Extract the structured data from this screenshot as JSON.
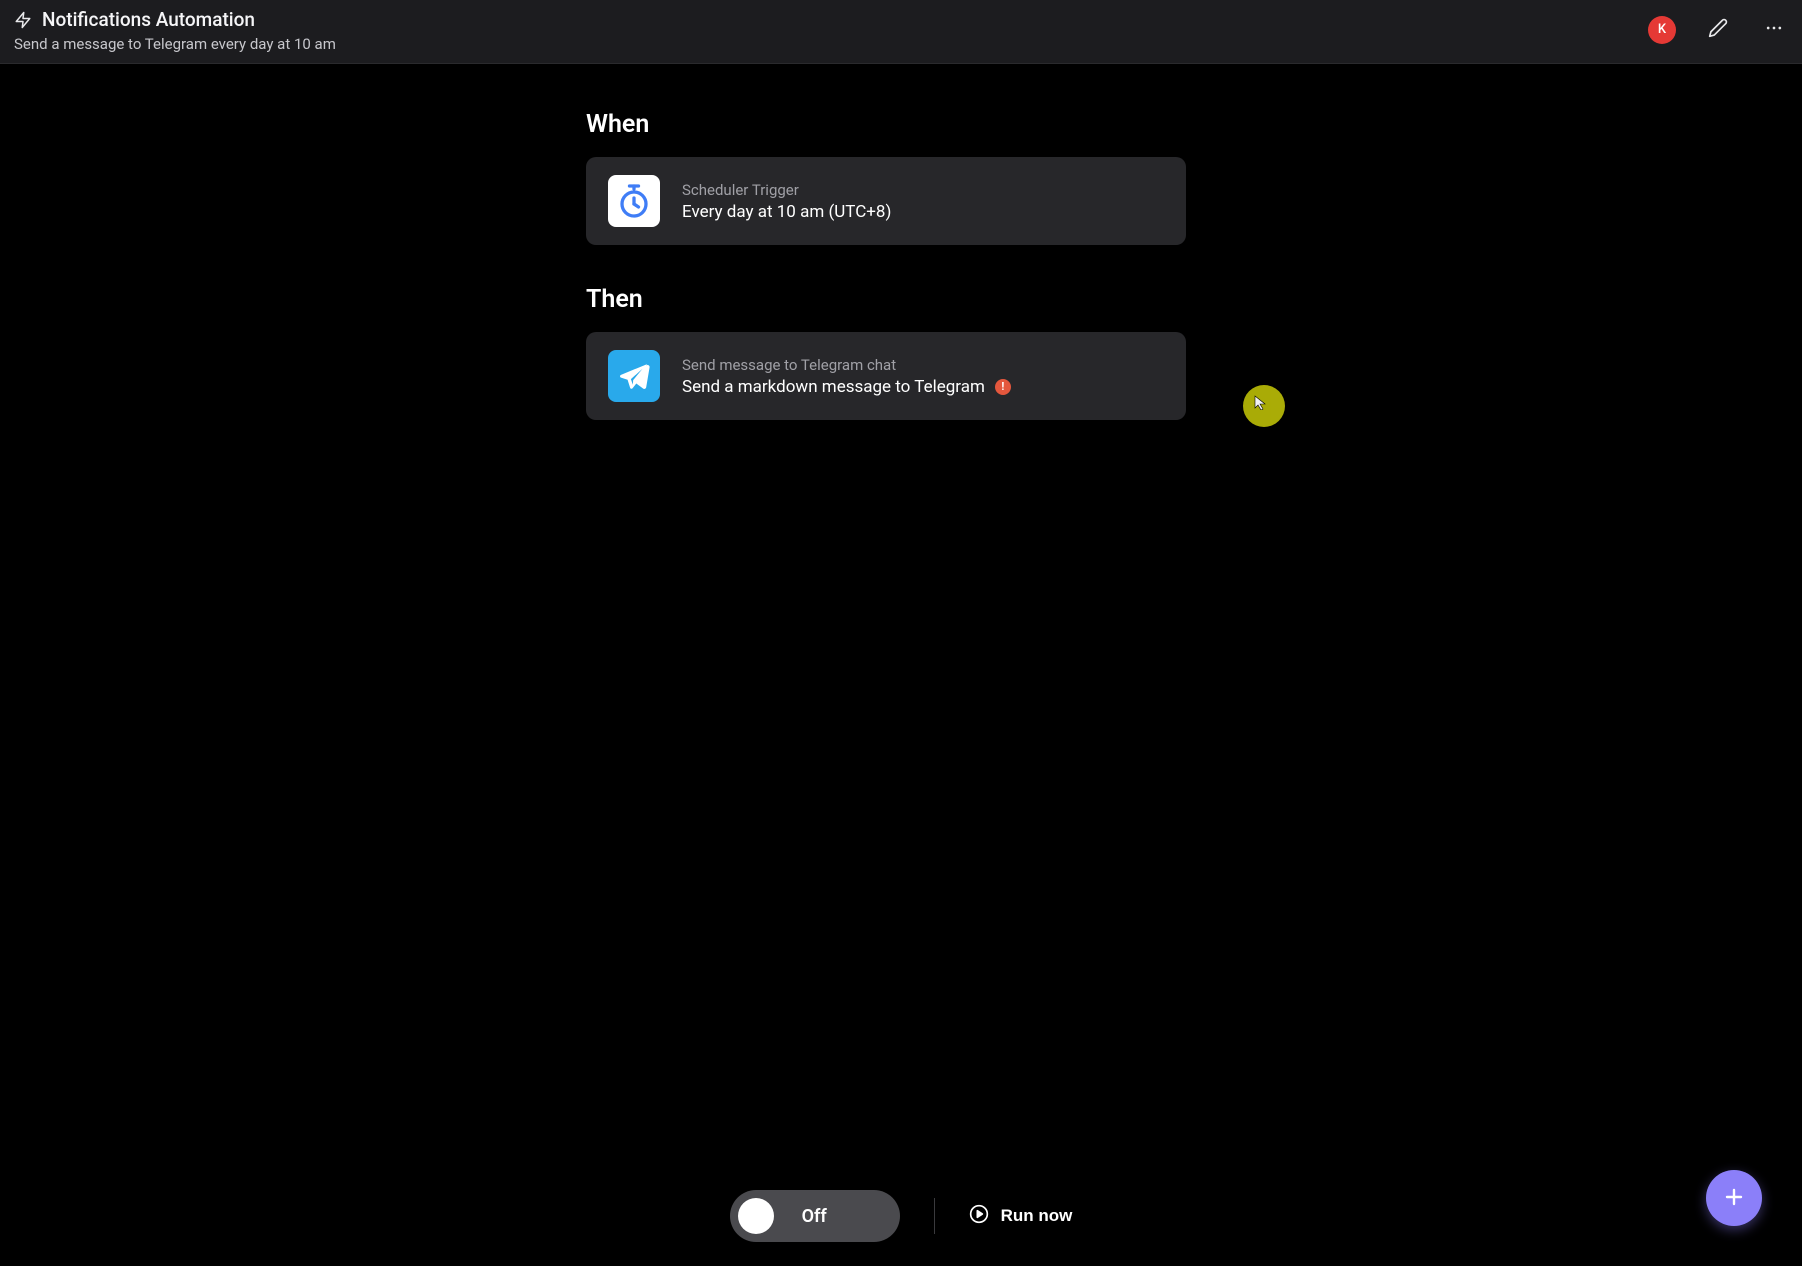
{
  "header": {
    "title": "Notifications Automation",
    "subtitle": "Send a message to Telegram every day at 10 am",
    "avatar_letter": "K"
  },
  "sections": {
    "when": {
      "heading": "When",
      "card": {
        "label": "Scheduler Trigger",
        "title": "Every day at 10 am (UTC+8)"
      }
    },
    "then": {
      "heading": "Then",
      "card": {
        "label": "Send message to Telegram chat",
        "title": "Send a markdown message to Telegram",
        "has_warning": true,
        "warning_glyph": "!"
      }
    }
  },
  "bottom": {
    "toggle_state": "Off",
    "run_label": "Run now"
  }
}
